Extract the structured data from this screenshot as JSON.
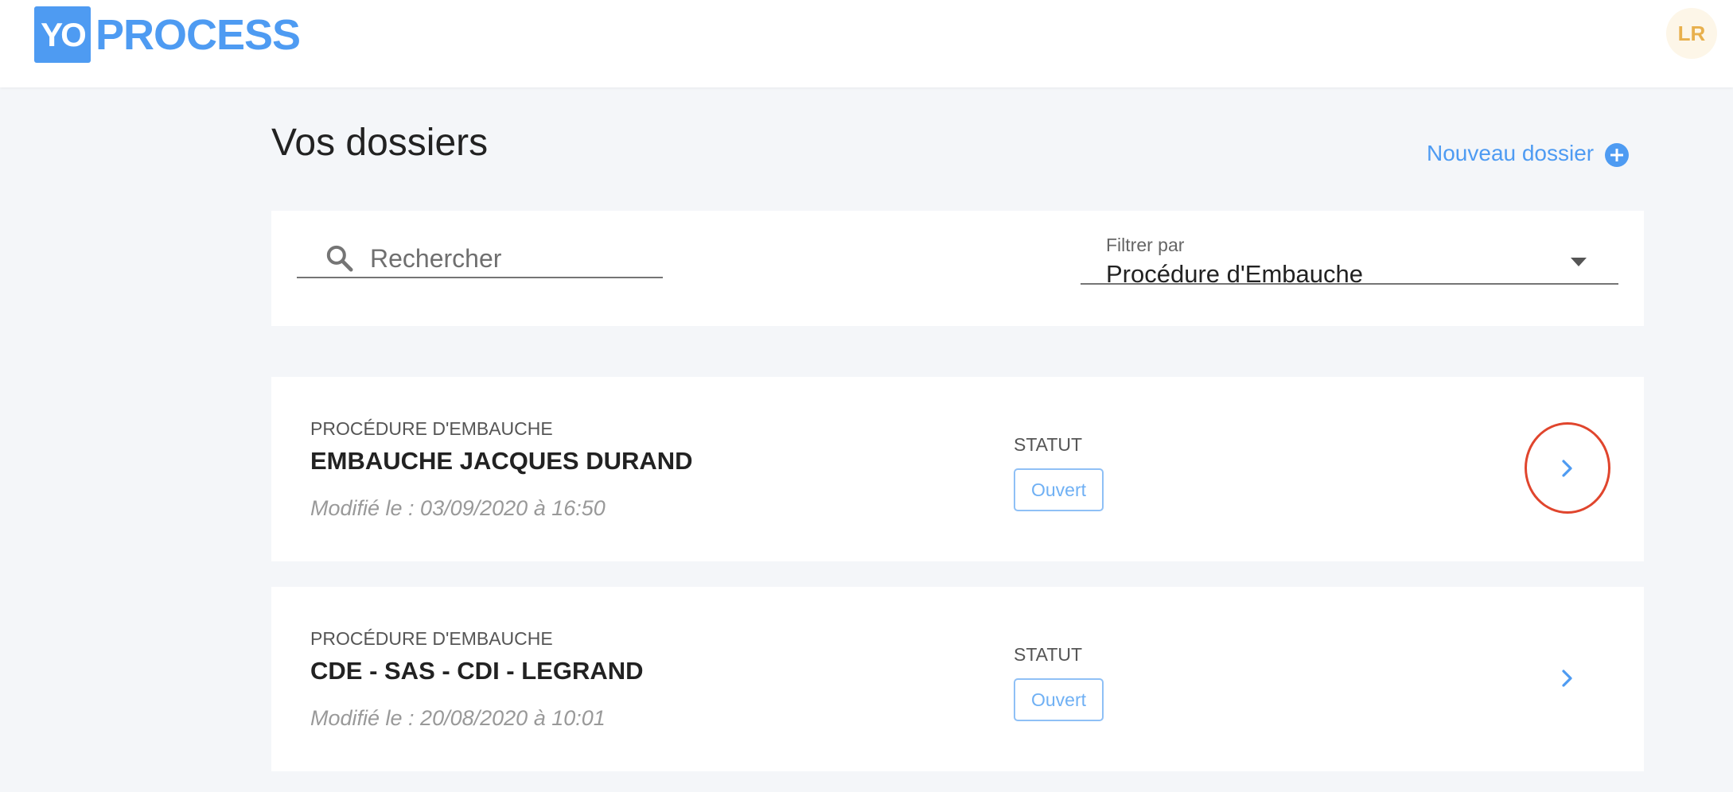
{
  "header": {
    "logo_mark": "YO",
    "logo_text": "PROCESS",
    "avatar_initials": "LR"
  },
  "page": {
    "title": "Vos dossiers",
    "new_folder_label": "Nouveau dossier"
  },
  "filters": {
    "search_placeholder": "Rechercher",
    "search_value": "",
    "filter_label": "Filtrer par",
    "filter_value": "Procédure d'Embauche"
  },
  "folders": [
    {
      "type": "PROCÉDURE D'EMBAUCHE",
      "title": "EMBAUCHE JACQUES DURAND",
      "modified": "Modifié le : 03/09/2020 à 16:50",
      "status_label": "STATUT",
      "status": "Ouvert",
      "highlighted": true
    },
    {
      "type": "PROCÉDURE D'EMBAUCHE",
      "title": "CDE - SAS - CDI - LEGRAND",
      "modified": "Modifié le : 20/08/2020 à 10:01",
      "status_label": "STATUT",
      "status": "Ouvert",
      "highlighted": false
    }
  ],
  "colors": {
    "brand": "#4e9bf2",
    "highlight": "#e0452d",
    "avatar_text": "#e8b04d"
  },
  "icons": {
    "search": "search-icon",
    "add": "plus-circle-icon",
    "dropdown": "caret-down-icon",
    "open": "chevron-right-icon"
  }
}
